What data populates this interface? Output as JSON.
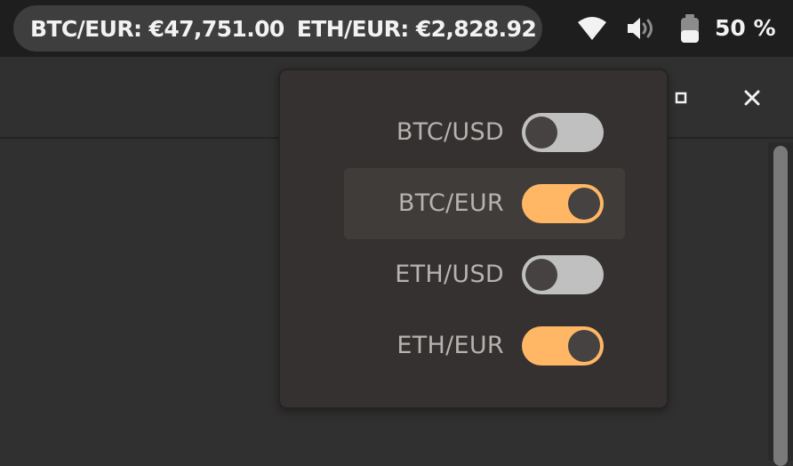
{
  "topbar": {
    "ticker": [
      {
        "pair": "BTC/EUR:",
        "price": "€47,751.00"
      },
      {
        "pair": "ETH/EUR:",
        "price": "€2,828.92"
      }
    ],
    "tray": {
      "wifi_icon": "wifi-icon",
      "volume_icon": "volume-icon",
      "battery_icon": "battery-icon",
      "battery_level": "50 %",
      "battery_fraction": 0.5
    }
  },
  "window": {
    "controls": {
      "maximize_icon": "maximize-icon",
      "close_icon": "close-icon"
    }
  },
  "popover": {
    "items": [
      {
        "label": "BTC/USD",
        "enabled": false,
        "hovered": false
      },
      {
        "label": "BTC/EUR",
        "enabled": true,
        "hovered": true
      },
      {
        "label": "ETH/USD",
        "enabled": false,
        "hovered": false
      },
      {
        "label": "ETH/EUR",
        "enabled": true,
        "hovered": false
      }
    ]
  },
  "colors": {
    "accent": "#ffb765",
    "switch_off": "#c0c0c0",
    "popover_bg": "#353130",
    "topbar_bg": "#1e1e1e"
  }
}
